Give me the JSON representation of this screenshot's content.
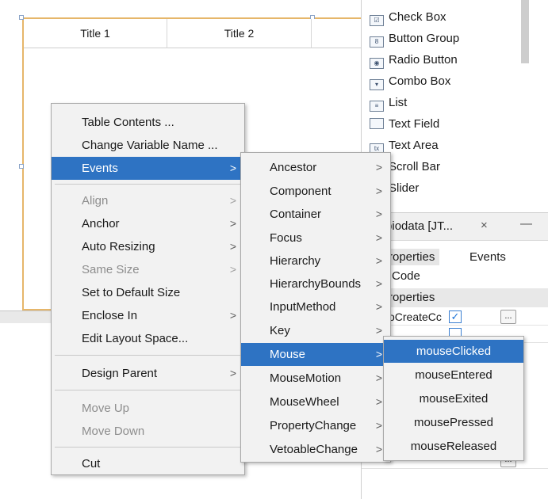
{
  "table": {
    "title_1": "Title 1",
    "title_2": "Title 2"
  },
  "palette": {
    "items": [
      {
        "label": "Check Box",
        "icon": "checkbox-icon"
      },
      {
        "label": "Button Group",
        "icon": "button-group-icon"
      },
      {
        "label": "Radio Button",
        "icon": "radio-button-icon"
      },
      {
        "label": "Combo Box",
        "icon": "combo-box-icon"
      },
      {
        "label": "List",
        "icon": "list-icon"
      },
      {
        "label": "Text Field",
        "icon": "text-field-icon"
      },
      {
        "label": "Text Area",
        "icon": "text-area-icon"
      },
      {
        "label": "Scroll Bar",
        "icon": "scroll-bar-icon"
      },
      {
        "label": "Slider",
        "icon": "slider-icon"
      }
    ],
    "text_area_icon_text": "tx"
  },
  "properties": {
    "window_title": "el_biodata [JT...",
    "close_glyph": "×",
    "minimize_glyph": "—",
    "tab_properties": "roperties",
    "tab_events": "Events",
    "tab_code": "Code",
    "group_label": "roperties",
    "row_1": "oCreateCc",
    "row_1_check": "✓",
    "ellipsis": "..."
  },
  "context_menu": {
    "items": [
      {
        "label": "Table Contents ...",
        "enabled": true
      },
      {
        "label": "Change Variable Name ...",
        "enabled": true
      },
      {
        "label": "Events",
        "enabled": true,
        "submenu": true,
        "highlighted": true
      },
      {
        "label": "Align",
        "enabled": false,
        "submenu": true
      },
      {
        "label": "Anchor",
        "enabled": true,
        "submenu": true
      },
      {
        "label": "Auto Resizing",
        "enabled": true,
        "submenu": true
      },
      {
        "label": "Same Size",
        "enabled": false,
        "submenu": true
      },
      {
        "label": "Set to Default Size",
        "enabled": true
      },
      {
        "label": "Enclose In",
        "enabled": true,
        "submenu": true
      },
      {
        "label": "Edit Layout Space...",
        "enabled": true
      },
      {
        "label": "Design Parent",
        "enabled": true,
        "submenu": true
      },
      {
        "label": "Move Up",
        "enabled": false
      },
      {
        "label": "Move Down",
        "enabled": false
      },
      {
        "label": "Cut",
        "enabled": true
      }
    ],
    "arrow": ">"
  },
  "events_menu": {
    "items": [
      "Ancestor",
      "Component",
      "Container",
      "Focus",
      "Hierarchy",
      "HierarchyBounds",
      "InputMethod",
      "Key",
      "Mouse",
      "MouseMotion",
      "MouseWheel",
      "PropertyChange",
      "VetoableChange"
    ],
    "highlighted": "Mouse"
  },
  "mouse_menu": {
    "items": [
      "mouseClicked",
      "mouseEntered",
      "mouseExited",
      "mousePressed",
      "mouseReleased"
    ],
    "highlighted": "mouseClicked"
  },
  "colors": {
    "highlight": "#2e73c3",
    "menu_bg": "#f2f2f2",
    "frame_border": "#e6b66a"
  }
}
